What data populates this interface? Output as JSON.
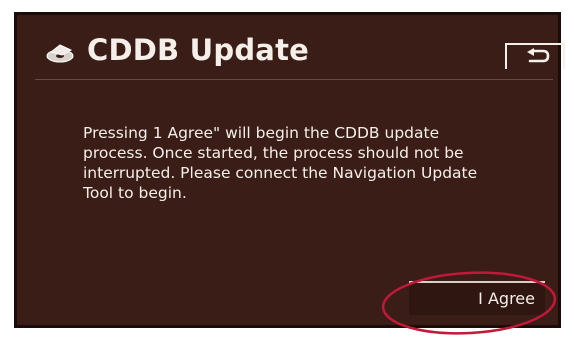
{
  "screen": {
    "title": "CDDB Update",
    "title_icon": "disc-icon",
    "back_icon": "return-arrow-icon",
    "message": "Pressing 1 Agree\" will begin the CDDB update process.  Once started, the process should not be interrupted.  Please connect the Navigation Update Tool to begin.",
    "agree_label": "I Agree"
  },
  "colors": {
    "screen_background": "#3a1d16",
    "text": "#f5efe9",
    "annotation": "#c2183a"
  }
}
